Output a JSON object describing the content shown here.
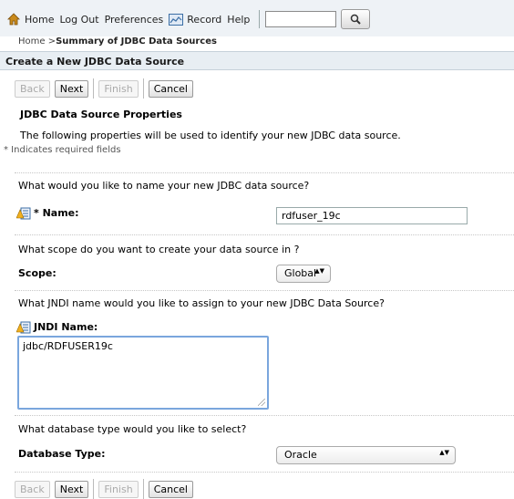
{
  "toolbar": {
    "home": "Home",
    "logout": "Log Out",
    "preferences": "Preferences",
    "record": "Record",
    "help": "Help",
    "search_value": ""
  },
  "breadcrumb": {
    "home": "Home",
    "sep": " >",
    "current": "Summary of JDBC Data Sources"
  },
  "section_title": "Create a New JDBC Data Source",
  "buttons": {
    "back": "Back",
    "next": "Next",
    "finish": "Finish",
    "cancel": "Cancel"
  },
  "properties": {
    "title": "JDBC Data Source Properties",
    "description": "The following properties will be used to identify your new JDBC data source.",
    "required_note": "* Indicates required fields"
  },
  "name_field": {
    "question": "What would you like to name your new JDBC data source?",
    "label": "* Name:",
    "value": "rdfuser_19c"
  },
  "scope_field": {
    "question": "What scope do you want to create your data source in ?",
    "label": "Scope:",
    "value": "Global"
  },
  "jndi_field": {
    "question": "What JNDI name would you like to assign to your new JDBC Data Source?",
    "label": "JNDI Name:",
    "value": "jdbc/RDFUSER19c"
  },
  "dbtype_field": {
    "question": "What database type would you like to select?",
    "label": "Database Type:",
    "value": "Oracle"
  }
}
